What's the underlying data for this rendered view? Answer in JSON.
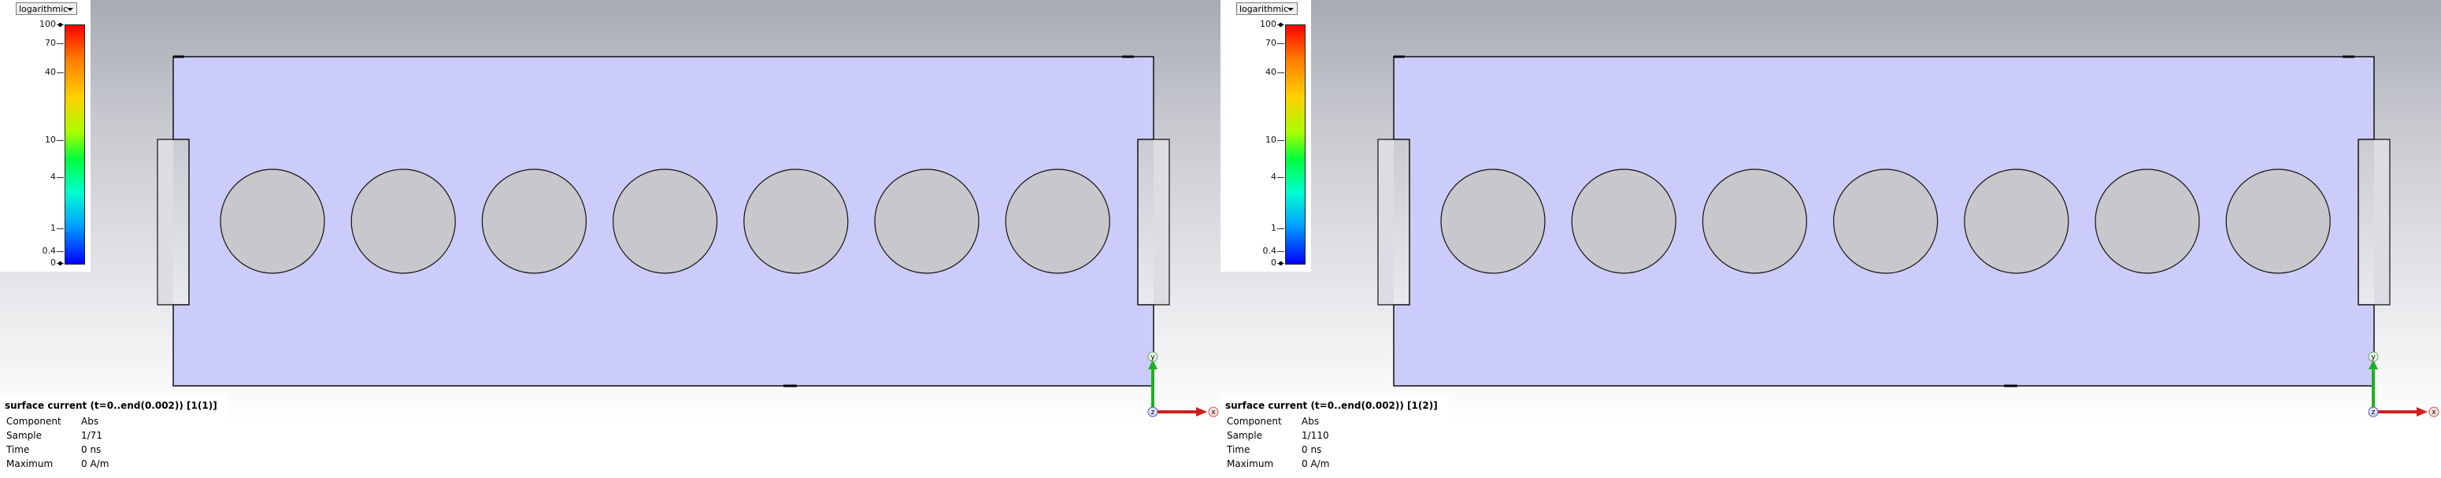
{
  "views": [
    {
      "legend": {
        "scale": "logarithmic",
        "ticks": [
          {
            "label": "100",
            "level": 1.0
          },
          {
            "label": "70",
            "level": 0.92
          },
          {
            "label": "40",
            "level": 0.8
          },
          {
            "label": "10",
            "level": 0.515
          },
          {
            "label": "4",
            "level": 0.36
          },
          {
            "label": "1",
            "level": 0.145
          },
          {
            "label": "0.4",
            "level": 0.05
          },
          {
            "label": "0",
            "level": 0.0
          }
        ]
      },
      "info": {
        "title": "surface current (t=0..end(0.002)) [1(1)]",
        "rows": [
          {
            "key": "Component",
            "value": "Abs"
          },
          {
            "key": "Sample",
            "value": "1/71"
          },
          {
            "key": "Time",
            "value": "0 ns"
          },
          {
            "key": "Maximum",
            "value": "0 A/m"
          }
        ]
      },
      "axes": {
        "y": "y",
        "x": "x",
        "z": "z"
      }
    },
    {
      "legend": {
        "scale": "logarithmic",
        "ticks": [
          {
            "label": "100",
            "level": 1.0
          },
          {
            "label": "70",
            "level": 0.92
          },
          {
            "label": "40",
            "level": 0.8
          },
          {
            "label": "10",
            "level": 0.515
          },
          {
            "label": "4",
            "level": 0.36
          },
          {
            "label": "1",
            "level": 0.145
          },
          {
            "label": "0.4",
            "level": 0.05
          },
          {
            "label": "0",
            "level": 0.0
          }
        ]
      },
      "info": {
        "title": "surface current (t=0..end(0.002)) [1(2)]",
        "rows": [
          {
            "key": "Component",
            "value": "Abs"
          },
          {
            "key": "Sample",
            "value": "1/110"
          },
          {
            "key": "Time",
            "value": "0 ns"
          },
          {
            "key": "Maximum",
            "value": "0 A/m"
          }
        ]
      },
      "axes": {
        "y": "y",
        "x": "x",
        "z": "z"
      }
    }
  ],
  "colors": {
    "plate": "#ccccfa",
    "hole": "#c8c8cc",
    "outline": "#111111",
    "x_axis": "#d02020",
    "y_axis": "#20b020"
  },
  "holes_count": 7
}
